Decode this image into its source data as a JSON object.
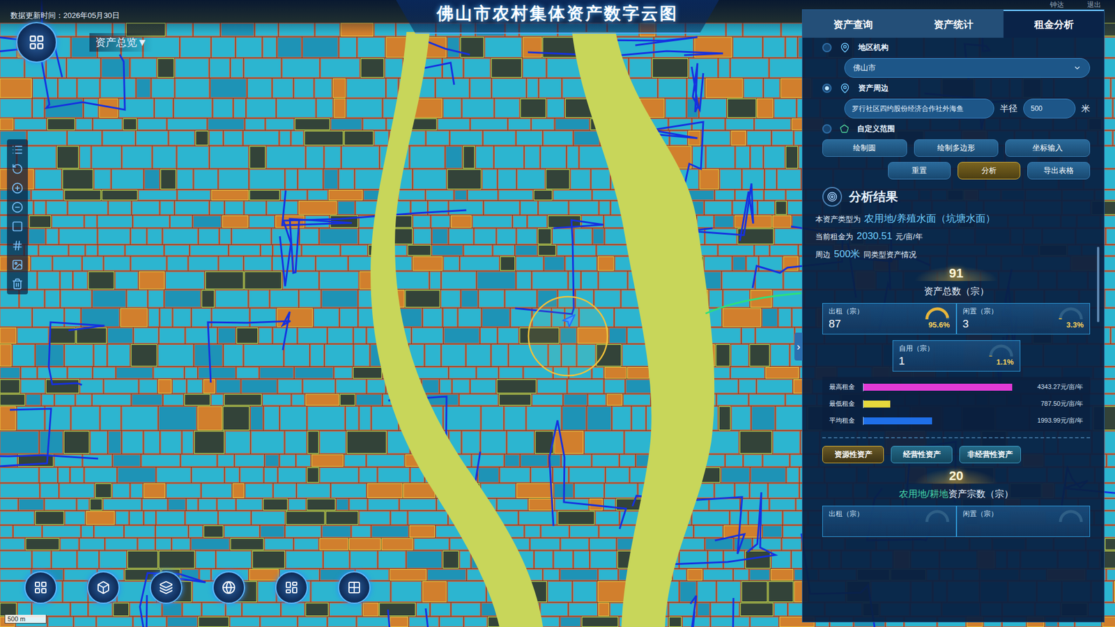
{
  "header": {
    "update_time": "数据更新时间：2026年05月30日",
    "title": "佛山市农村集体资产数字云图",
    "user": "钟达",
    "logout": "退出"
  },
  "overview_menu": {
    "label": "资产总览",
    "caret": "▼"
  },
  "map": {
    "scale_label": "500 m"
  },
  "panel": {
    "tabs": [
      {
        "label": "资产查询",
        "selected": false
      },
      {
        "label": "资产统计",
        "selected": false
      },
      {
        "label": "租金分析",
        "selected": true
      }
    ],
    "scopes": [
      {
        "label": "地区机构",
        "selected": false,
        "kind": "select",
        "value": "佛山市"
      },
      {
        "label": "资产周边",
        "selected": true,
        "kind": "radius",
        "value": "罗行社区四约股份经济合作社外海鱼",
        "radius_label": "半径",
        "radius": "500",
        "unit": "米"
      },
      {
        "label": "自定义范围",
        "selected": false,
        "kind": "draw"
      }
    ],
    "draw_buttons": [
      "绘制圆",
      "绘制多边形",
      "坐标输入"
    ],
    "actions": [
      {
        "label": "重置",
        "selected": false
      },
      {
        "label": "分析",
        "selected": true
      },
      {
        "label": "导出表格",
        "selected": false
      }
    ],
    "result": {
      "title": "分析结果",
      "type_prefix": "本资产类型为",
      "type": "农用地/养殖水面（坑塘水面）",
      "rent_prefix": "当前租金为",
      "rent": "2030.51",
      "rent_unit": "元/亩/年",
      "around_prefix": "周边",
      "around_radius": "500米",
      "around_suffix": "同类型资产情况",
      "total": "91",
      "total_label": "资产总数（宗）",
      "stats": [
        {
          "label": "出租（宗）",
          "value": "87",
          "percent": "95.6%",
          "level": 0.956
        },
        {
          "label": "闲置（宗）",
          "value": "3",
          "percent": "3.3%",
          "level": 0.033
        },
        {
          "label": "自用（宗）",
          "value": "1",
          "percent": "1.1%",
          "level": 0.011
        }
      ],
      "rent_chart": {
        "bars": [
          {
            "label": "最高租金",
            "value": 4343.27,
            "reading": "4343.27元/亩/年",
            "color": "#e23ad6"
          },
          {
            "label": "最低租金",
            "value": 787.5,
            "reading": "787.50元/亩/年",
            "color": "#e6d83c"
          },
          {
            "label": "平均租金",
            "value": 1993.99,
            "reading": "1993.99元/亩/年",
            "color": "#1f6fe8"
          }
        ]
      }
    },
    "categories": [
      {
        "label": "资源性资产",
        "selected": true
      },
      {
        "label": "经营性资产",
        "selected": false
      },
      {
        "label": "非经营性资产",
        "selected": false
      }
    ],
    "category_result": {
      "total": "20",
      "type": "农用地/耕地",
      "suffix": "资产宗数（宗）",
      "stats": [
        {
          "label": "出租（宗）"
        },
        {
          "label": "闲置（宗）"
        }
      ]
    },
    "collapse_icon": "›"
  }
}
